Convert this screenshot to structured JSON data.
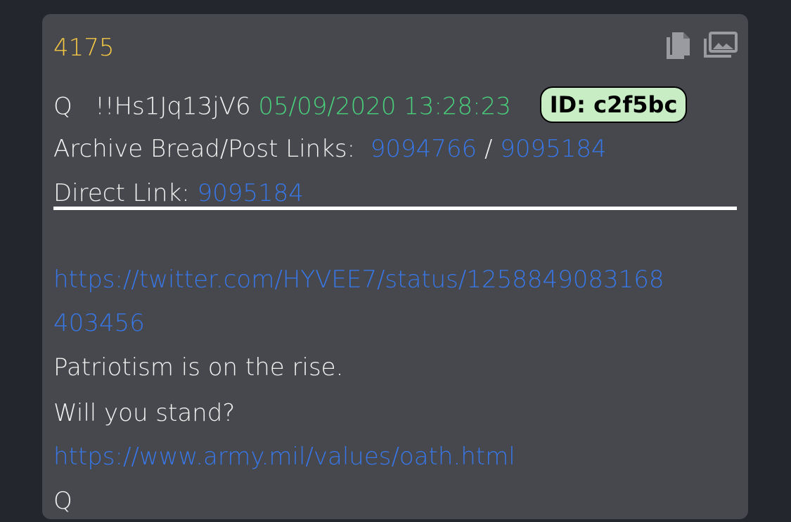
{
  "post": {
    "number": "4175",
    "author": "Q",
    "tripcode": "!!Hs1Jq13jV6",
    "datetime": "05/09/2020 13:28:23",
    "id_badge": "ID: c2f5bc",
    "archive_label": "Archive Bread/Post Links:",
    "archive_bread_link": "9094766",
    "archive_separator": "/",
    "archive_post_link": "9095184",
    "direct_label": "Direct Link:",
    "direct_link": "9095184",
    "body": {
      "url1_line1": "https://twitter.com/HYVEE7/status/1258849083168",
      "url1_line2": "403456",
      "text1": "Patriotism is on the rise.",
      "text2": "Will you stand?",
      "url2": "https://www.army.mil/values/oath.html",
      "signature": "Q"
    }
  },
  "toolbar": {
    "copy_icon": "copy-icon",
    "images_icon": "images-icon"
  },
  "colors": {
    "background": "#23262d",
    "card": "#47484d",
    "post_number": "#f3c644",
    "date": "#49d07c",
    "link": "#3777e8",
    "badge_bg": "#c8ecc4"
  }
}
